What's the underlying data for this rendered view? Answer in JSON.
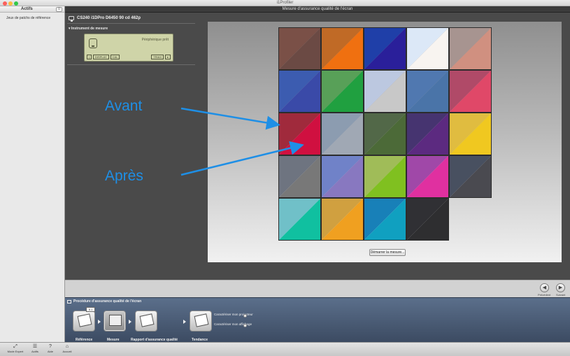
{
  "window": {
    "title": "i1Profiler"
  },
  "sidebar": {
    "tab_label": "Actifs",
    "badge": "0",
    "item": "Jeux de patchs de référence"
  },
  "header": {
    "title": "Mesure d'assurance qualité de l'écran"
  },
  "device": {
    "line": "CS240 i1DPro D6450 90 cd 462p",
    "instrument_label": "Instrument de mesure",
    "status": "Périphérique prêt",
    "lcd_buttons": [
      "DISPLAY",
      "CAL",
      "TRIAX"
    ]
  },
  "patches": [
    [
      "#7a5047",
      "#6b4a44",
      "#c06a26",
      "#f07010",
      "#1f3fa8",
      "#2a1f9a",
      "#dce8f7",
      "#f8f4f0",
      "#a79490",
      "#d09080"
    ],
    [
      "#3c5cb0",
      "#3a4aa8",
      "#58a058",
      "#20a040",
      "#bcc8e0",
      "#c8c8c8",
      "#5078b0",
      "#4a74a8",
      "#b04a68",
      "#e04868"
    ],
    [
      "#a02a3c",
      "#d01040",
      "#8c9cb0",
      "#a0a8b4",
      "#526848",
      "#4c6a38",
      "#463470",
      "#5c2a80",
      "#e0bc40",
      "#f0c820"
    ],
    [
      "#6e7480",
      "#787878",
      "#7082c8",
      "#8878c0",
      "#a0bc58",
      "#80c020",
      "#a048a8",
      "#e030a0",
      "#485060",
      "#4a4a50"
    ],
    [
      "#70c0c8",
      "#10c0a0",
      "#d0a040",
      "#f0a020",
      "#1880b8",
      "#10a0c0",
      "#303034",
      "#2e2e30",
      null,
      null
    ]
  ],
  "buttons": {
    "start": "Démarrer la mesure..."
  },
  "annotations": {
    "before": "Avant",
    "after": "Après"
  },
  "nav": {
    "previous": "Précédent",
    "next": "Suivant"
  },
  "workflow": {
    "title": "Procédure d'assurance qualité de l'écran",
    "ref_tag": "5.1",
    "steps": [
      "Référence",
      "Mesure",
      "Rapport d'assurance qualité",
      "Tendance"
    ],
    "options": [
      "Caractériser mon projecteur",
      "Caractériser mon affichage"
    ]
  },
  "toolbar": [
    "Mode Expert",
    "Actifs",
    "Aide",
    "Accueil"
  ],
  "colors": {
    "accent": "#1e8fe6",
    "workflow": "#4a5c78"
  }
}
